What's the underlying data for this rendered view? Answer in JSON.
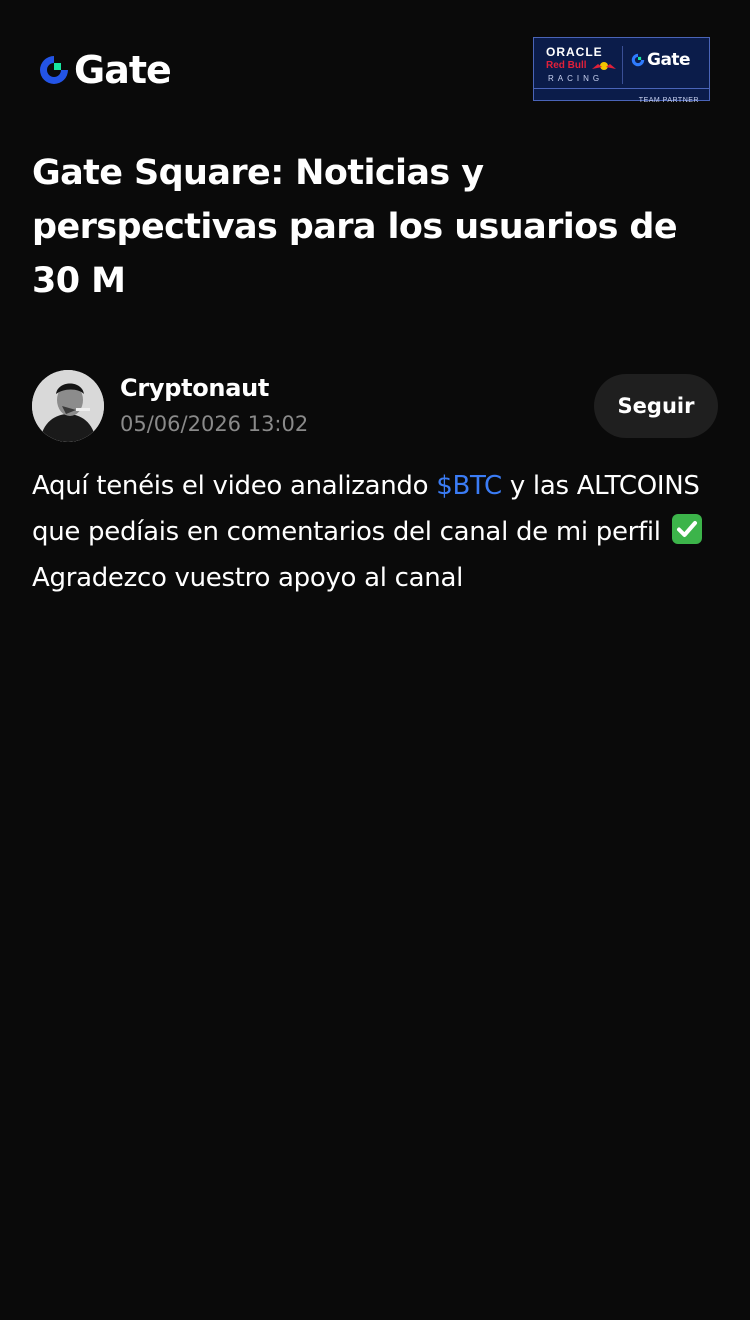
{
  "header": {
    "logo_text": "Gate",
    "partner": {
      "oracle": "ORACLE",
      "red_bull": "Red Bull",
      "racing": "RACING",
      "gate": "Gate",
      "footer": "TEAM PARTNER"
    }
  },
  "page": {
    "title": "Gate Square: Noticias y perspectivas para los usuarios de 30 M"
  },
  "post": {
    "author": "Cryptonaut",
    "timestamp": "05/06/2026 13:02",
    "follow_label": "Seguir",
    "body": {
      "part1": "Aquí tenéis el video analizando ",
      "ticker": "$BTC",
      "part2": " y las ALTCOINS que pedíais en comentarios del canal de mi perfil",
      "part3": " Agradezco vuestro apoyo al canal"
    }
  },
  "colors": {
    "background": "#0a0a0a",
    "accent_blue": "#3b7cf5",
    "logo_green": "#17e5a0",
    "logo_blue": "#2354e6",
    "muted_text": "#8a8a8a",
    "button_bg": "#1f1f1f",
    "check_green": "#3cb44a"
  },
  "icons": {
    "logo": "gate-logo-icon",
    "check": "check-mark-button-icon"
  }
}
